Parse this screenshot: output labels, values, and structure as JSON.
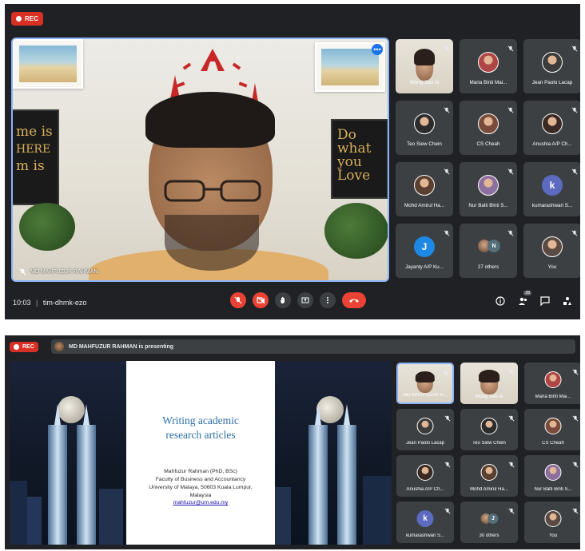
{
  "top": {
    "rec_label": "REC",
    "main_speaker": {
      "name": "MD MAHFUZUR RAHMAN",
      "painting_text": [
        "Do",
        "what",
        "you",
        "Love"
      ],
      "left_canvas_text": [
        "me is",
        "HERE",
        "m is"
      ]
    },
    "participants": [
      {
        "name": "Wong Jian Ai",
        "kind": "video"
      },
      {
        "name": "Maria Binti Mai...",
        "kind": "photo",
        "color": "#b04545"
      },
      {
        "name": "Jean Paolo Lacap",
        "kind": "photo",
        "color": "#3c3c3c"
      },
      {
        "name": "Teo Siew Chein",
        "kind": "photo",
        "color": "#2b2b2b"
      },
      {
        "name": "CS Cheah",
        "kind": "photo",
        "color": "#7a4b3a"
      },
      {
        "name": "Anushia A/P Ch...",
        "kind": "photo",
        "color": "#3b2a24"
      },
      {
        "name": "Mohd Amirul Ha...",
        "kind": "photo",
        "color": "#5b3f30"
      },
      {
        "name": "Nur Balti Binti S...",
        "kind": "photo",
        "color": "#8c6f9e"
      },
      {
        "name": "kumarashwari S...",
        "kind": "letter",
        "letter": "k",
        "color": "#5c6bc0"
      },
      {
        "name": "Jayanty A/P Ku...",
        "kind": "letter",
        "letter": "J",
        "color": "#1e88e5"
      },
      {
        "name": "27 others",
        "kind": "others",
        "letter": "N"
      },
      {
        "name": "You",
        "kind": "photo",
        "color": "#5a4a42"
      }
    ],
    "time": "10:03",
    "meeting_code": "tim-dhmk-ezo",
    "people_count": "28"
  },
  "bottom": {
    "rec_label": "REC",
    "presenting_text": "MD MAHFUZUR RAHMAN is presenting",
    "slide": {
      "title_line1": "Writing academic",
      "title_line2": "research articles",
      "author": "Mahfuzur Rahman (PhD, BSc)",
      "faculty": "Faculty of Business and Accountancy",
      "address": "University of Malaya, 50603 Kuala Lumpur,",
      "country": "Malaysia",
      "email": "mahfuzur@um.edu.my"
    },
    "participants": [
      {
        "name": "MD MAHFUZUR R...",
        "kind": "video"
      },
      {
        "name": "Wong Jian Ai",
        "kind": "video"
      },
      {
        "name": "Maria Binti Mai...",
        "kind": "photo",
        "color": "#b04545"
      },
      {
        "name": "Jean Paolo Lacap",
        "kind": "photo",
        "color": "#3c3c3c"
      },
      {
        "name": "Teo Siew Chein",
        "kind": "photo",
        "color": "#2b2b2b"
      },
      {
        "name": "CS Cheah",
        "kind": "photo",
        "color": "#7a4b3a"
      },
      {
        "name": "Anushia A/P Ch...",
        "kind": "photo",
        "color": "#3b2a24"
      },
      {
        "name": "Mohd Amirul Ha...",
        "kind": "photo",
        "color": "#5b3f30"
      },
      {
        "name": "Nur Balti Binti S...",
        "kind": "photo",
        "color": "#8c6f9e"
      },
      {
        "name": "kumarashwari S...",
        "kind": "letter",
        "letter": "k",
        "color": "#5c6bc0"
      },
      {
        "name": "30 others",
        "kind": "others",
        "letter": "J"
      },
      {
        "name": "You",
        "kind": "photo",
        "color": "#5a4a42"
      }
    ]
  },
  "colors": {
    "panel_bg": "#202124",
    "tile_bg": "#3c4043",
    "rec_red": "#d93025",
    "active_border": "#8ab4f8",
    "slide_title": "#2e6fa8"
  }
}
